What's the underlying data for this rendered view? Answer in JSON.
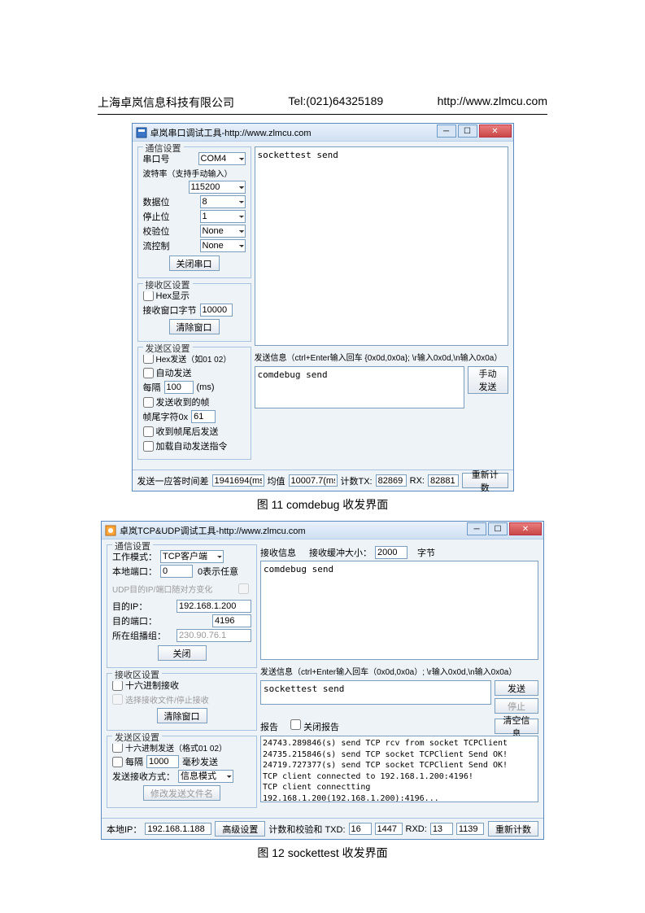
{
  "header": {
    "company": "上海卓岚信息科技有限公司",
    "tel": "Tel:(021)64325189",
    "url": "http://www.zlmcu.com"
  },
  "caption1": "图 11 comdebug 收发界面",
  "caption2": "图 12 sockettest 收发界面",
  "win1": {
    "title": "卓岚串口调试工具-http://www.zlmcu.com",
    "comm_group": "通信设置",
    "port_lbl": "串口号",
    "port_val": "COM4",
    "baud_lbl": "波特率（支持手动输入）",
    "baud_val": "115200",
    "databits_lbl": "数据位",
    "databits_val": "8",
    "stopbits_lbl": "停止位",
    "stopbits_val": "1",
    "parity_lbl": "校验位",
    "parity_val": "None",
    "flow_lbl": "流控制",
    "flow_val": "None",
    "close_port_btn": "关闭串口",
    "recv_group": "接收区设置",
    "hex_disp": "Hex显示",
    "recv_bytes_lbl": "接收窗口字节",
    "recv_bytes_val": "10000",
    "clear_win_btn": "清除窗口",
    "send_group": "发送区设置",
    "hex_send": "Hex发送（如01 02）",
    "auto_send": "自动发送",
    "interval_lbl": "每隔",
    "interval_val": "100",
    "interval_ms": "(ms)",
    "send_recv_frame": "发送收到的帧",
    "frame_tail_lbl": "帧尾字符0x",
    "frame_tail_val": "61",
    "send_after_tail": "收到帧尾后发送",
    "load_auto_cmd": "加载自动发送指令",
    "recv_area_text": "sockettest send",
    "send_info_lbl": "发送信息（ctrl+Enter输入回车 {0x0d,0x0a}; \\r输入0x0d,\\n输入0x0a）",
    "send_text": "comdebug send",
    "manual_send_btn": "手动发送",
    "status_resp_diff": "发送一应答时间差",
    "status_resp_val": "1941694(ms)",
    "status_avg_lbl": "均值",
    "status_avg_val": "10007.7(ms)",
    "tx_lbl": "计数TX:",
    "tx_val": "82869",
    "rx_lbl": "RX:",
    "rx_val": "82881",
    "reset_btn": "重新计数"
  },
  "win2": {
    "title": "卓岚TCP&UDP调试工具-http://www.zlmcu.com",
    "comm_group": "通信设置",
    "mode_lbl": "工作模式：",
    "mode_val": "TCP客户端",
    "local_port_lbl": "本地端口：",
    "local_port_val": "0",
    "local_port_hint": "0表示任意",
    "udp_ip_follow": "UDP目的IP/端口随对方变化",
    "dest_ip_lbl": "目的IP：",
    "dest_ip_val": "192.168.1.200",
    "dest_port_lbl": "目的端口：",
    "dest_port_val": "4196",
    "group_lbl": "所在组播组：",
    "group_val": "230.90.76.1",
    "close_btn": "关闭",
    "recv_group": "接收区设置",
    "hex_recv": "十六进制接收",
    "select_recv_file": "选择接收文件/停止接收",
    "clear_btn": "清除窗口",
    "send_group": "发送区设置",
    "hex_send": "十六进制发送（格式01 02）",
    "interval_chk": "每隔",
    "interval_val": "1000",
    "interval_unit": "毫秒发送",
    "send_recv_mode_lbl": "发送接收方式：",
    "send_recv_mode_val": "信息模式",
    "edit_file_btn": "修改发送文件名",
    "recv_info_lbl": "接收信息",
    "recv_buf_lbl": "接收缓冲大小：",
    "recv_buf_val": "2000",
    "recv_buf_unit": "字节",
    "recv_area_text": "comdebug send",
    "send_info_lbl": "发送信息（ctrl+Enter输入回车（0x0d,0x0a）; \\r输入0x0d,\\n输入0x0a）",
    "send_text": "sockettest send",
    "send_btn": "发送",
    "stop_btn": "停止",
    "report_lbl": "报告",
    "close_report_chk": "关闭报告",
    "clear_info_btn": "清空信息",
    "report_lines": [
      "24743.289846(s) send TCP rcv from socket TCPClient",
      "24735.215846(s) send TCP socket TCPClient Send OK!",
      "24719.727377(s) send TCP socket TCPClient Send OK!",
      "TCP client connected to 192.168.1.200:4196!",
      "TCP client connectting 192.168.1.200(192.168.1.200):4196..."
    ],
    "local_ip_lbl": "本地IP：",
    "local_ip_val": "192.168.1.188",
    "adv_btn": "高级设置",
    "cksum_lbl": "计数和校验和 TXD:",
    "txd1": "16",
    "txd2": "1447",
    "rxd_lbl": "RXD:",
    "rxd1": "13",
    "rxd2": "1139",
    "reset_btn": "重新计数"
  }
}
